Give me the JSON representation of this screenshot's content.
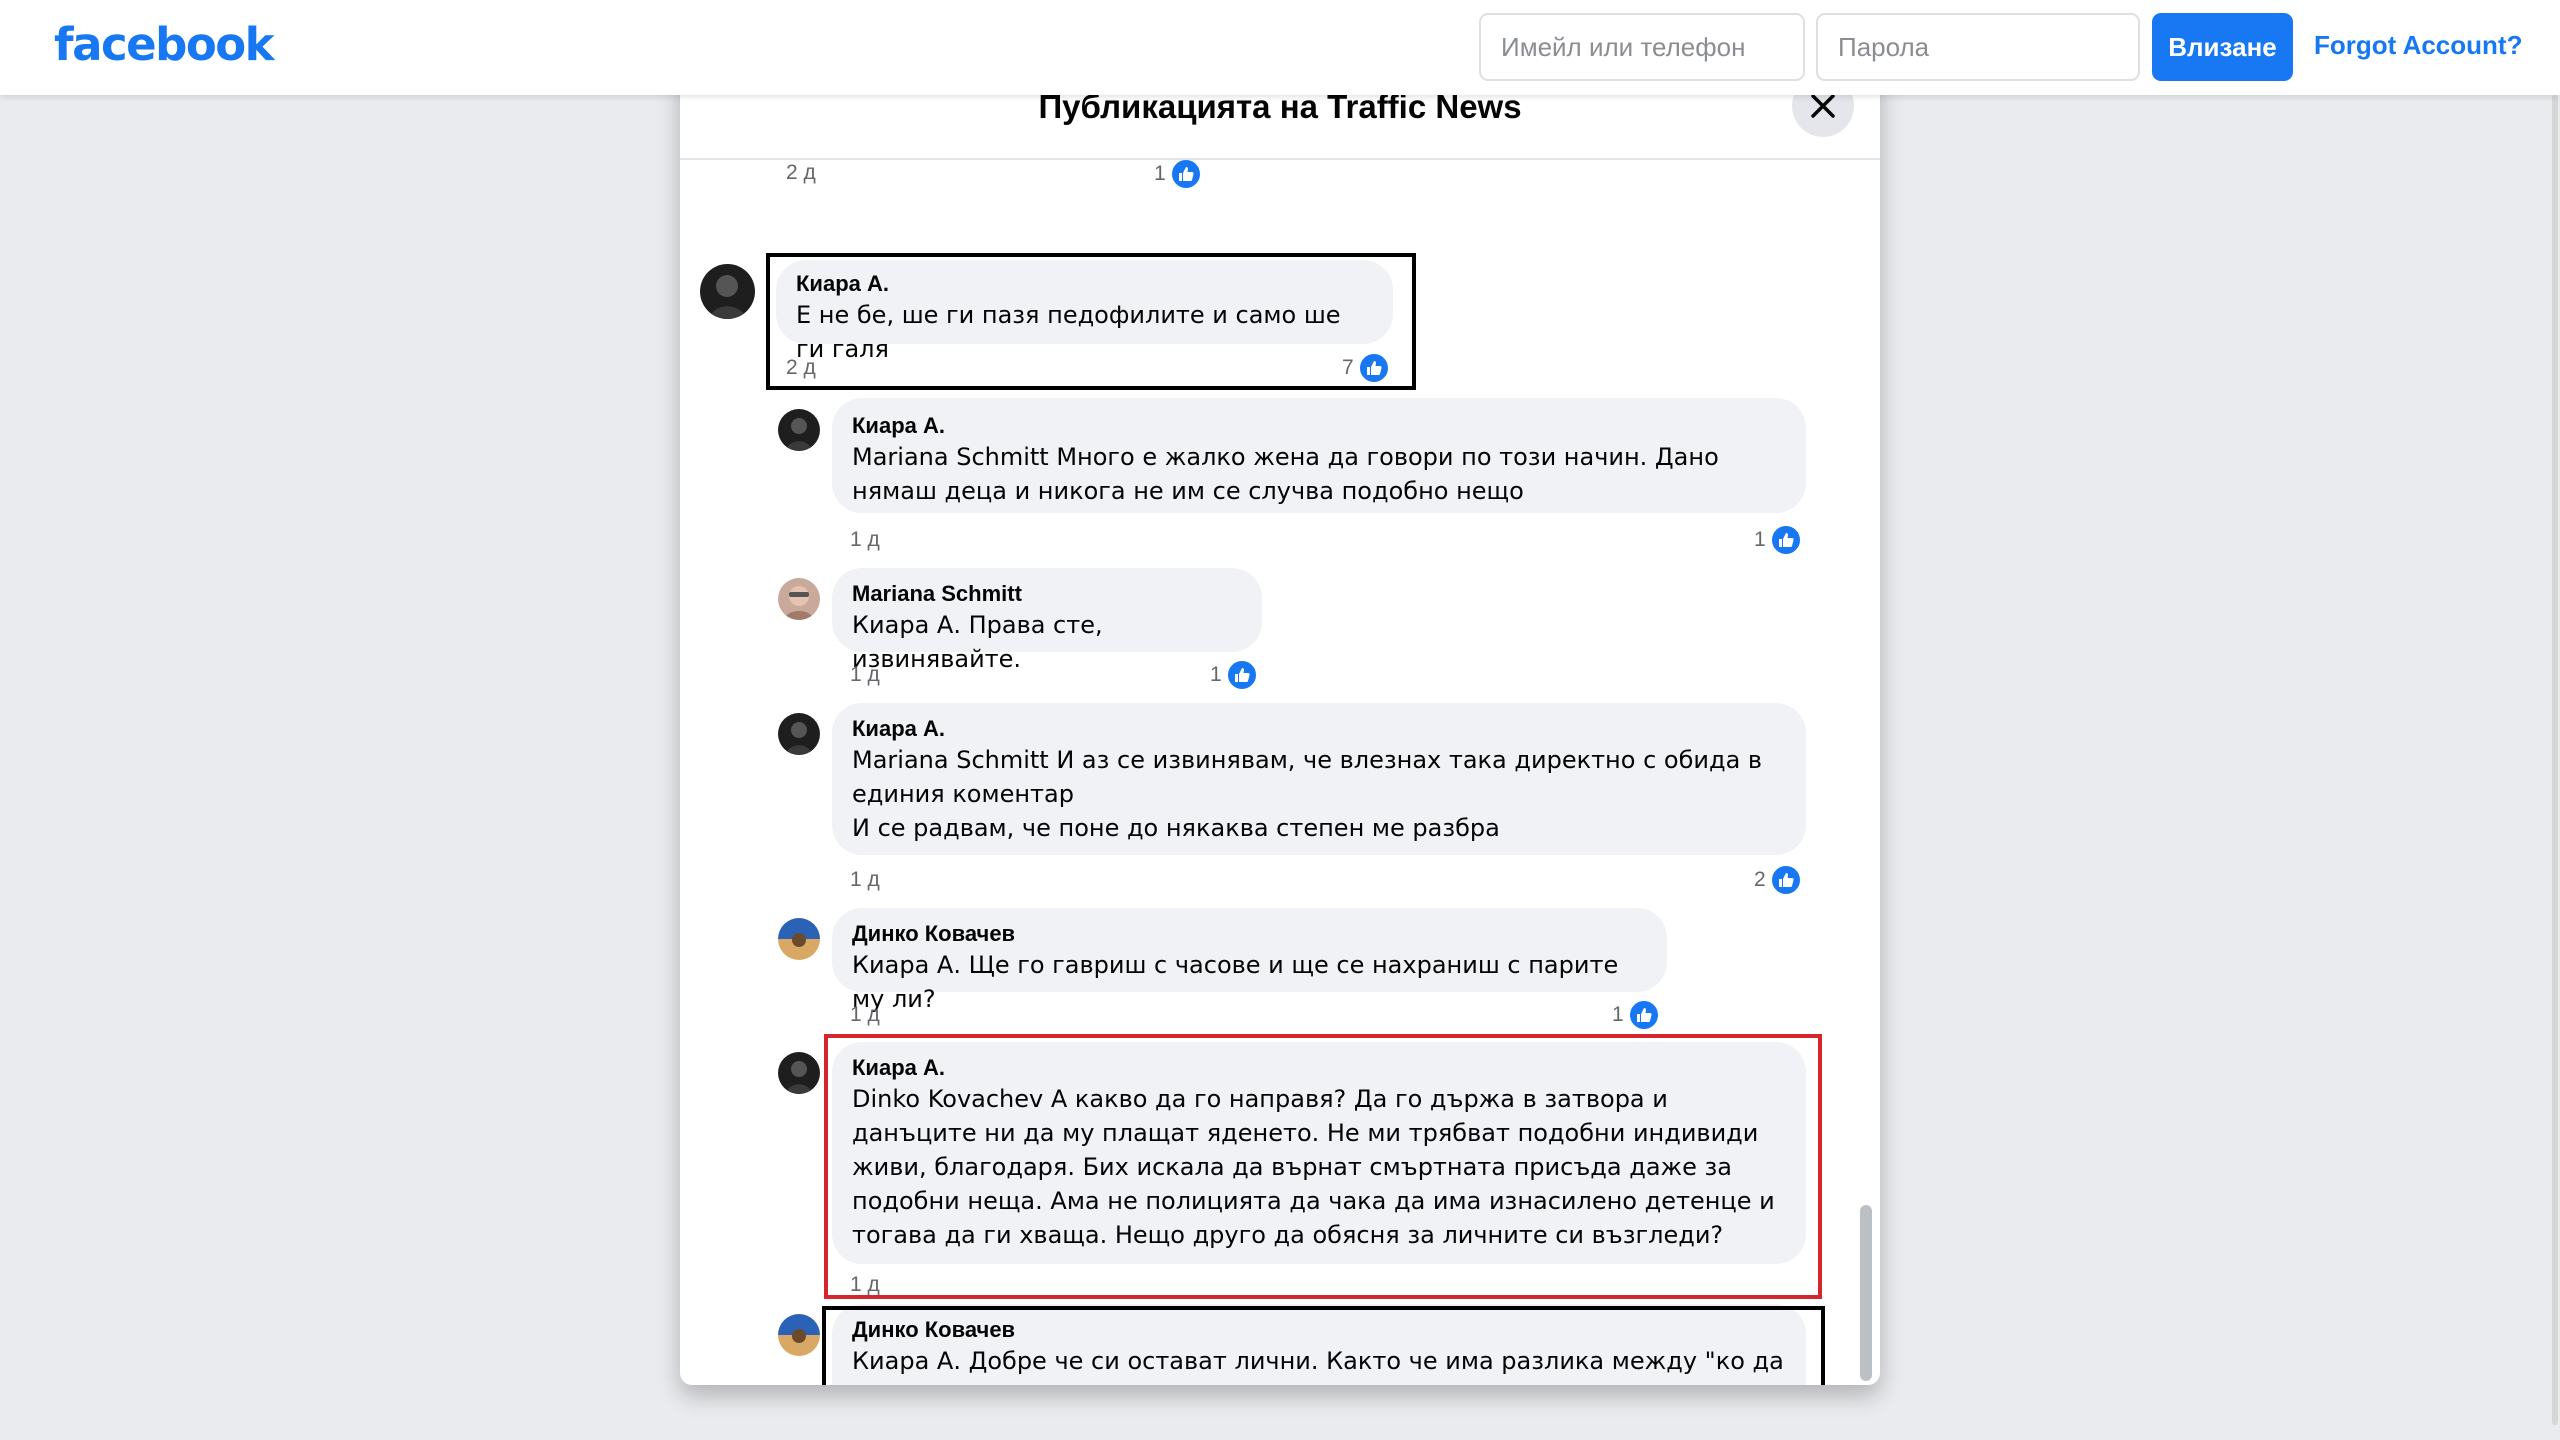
{
  "topbar": {
    "logo": "facebook",
    "email_placeholder": "Имейл или телефон",
    "password_placeholder": "Парола",
    "login_label": "Влизане",
    "forgot_label": "Forgot Account?"
  },
  "dialog": {
    "title": "Публикацията на Traffic News",
    "close_icon": "close-icon"
  },
  "previous": {
    "time": "2 д",
    "likes": "1"
  },
  "comments": [
    {
      "author": "Киара А.",
      "text": "Е не бе, ше ги пазя педофилите и само ше ги галя",
      "time": "2 д",
      "likes": "7"
    },
    {
      "author": "Киара А.",
      "text": "Mariana Schmitt Много е жалко жена да говори по този начин. Дано нямаш деца и никога не им се случва подобно нещо",
      "time": "1 д",
      "likes": "1"
    },
    {
      "author": "Mariana Schmitt",
      "text": "Киара А. Права сте, извинявайте.",
      "time": "1 д",
      "likes": "1"
    },
    {
      "author": "Киара А.",
      "text": "Mariana Schmitt И аз се извинявам, че влезнах така директно с обида в единия коментар\nИ се радвам, че поне до някаква степен ме разбра",
      "time": "1 д",
      "likes": "2"
    },
    {
      "author": "Динко Ковачев",
      "text": "Киара А. Ще го гавриш с часове и ще се нахраниш с парите му ли?",
      "time": "1 д",
      "likes": "1"
    },
    {
      "author": "Киара А.",
      "text": "Dinko Kovachev А какво да го направя? Да го държа в затвора и данъците ни да му плащат яденето. Не ми трябват подобни индивиди живи, благодаря. Бих искала да върнат смъртната присъда даже за подобни неща. Ама не полицията да чака да има изнасилено детенце и тогава да ги хваща. Нещо друго да обясня за личните си възгледи?",
      "time": "1 д",
      "likes": ""
    },
    {
      "author": "Динко Ковачев",
      "text": "Киара А. Добре че си остават лични. Както че има разлика между \"ко да го прая\" и направих го и примамих чичкото и доказан пдф.",
      "time": "",
      "likes": ""
    }
  ],
  "colors": {
    "brand": "#1877f2",
    "bubble": "#f0f2f5",
    "highlight_black": "#000000",
    "highlight_red": "#d5262e"
  }
}
